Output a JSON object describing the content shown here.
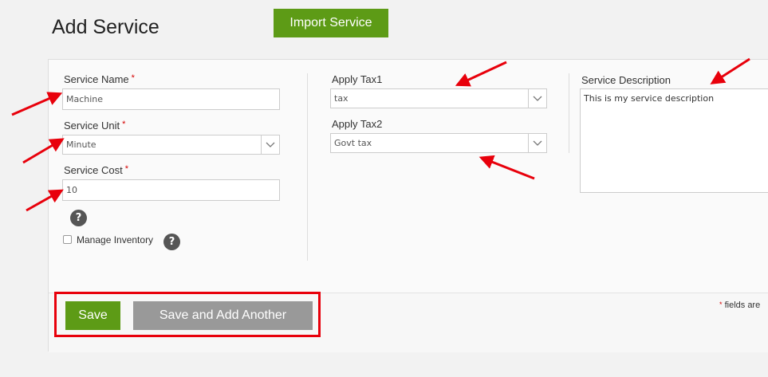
{
  "header": {
    "title": "Add Service",
    "import_label": "Import Service"
  },
  "form": {
    "service_name": {
      "label": "Service Name",
      "required": "*",
      "value": "Machine"
    },
    "service_unit": {
      "label": "Service Unit",
      "required": "*",
      "value": "Minute"
    },
    "service_cost": {
      "label": "Service Cost",
      "required": "*",
      "value": "10"
    },
    "help_glyph": "?",
    "manage_inventory": {
      "label": "Manage Inventory",
      "checked": false
    },
    "apply_tax1": {
      "label": "Apply Tax1",
      "value": "tax"
    },
    "apply_tax2": {
      "label": "Apply Tax2",
      "value": "Govt tax"
    },
    "description": {
      "label": "Service Description",
      "value": "This is my service description"
    }
  },
  "footer": {
    "save_label": "Save",
    "save_another_label": "Save and Add Another",
    "required_note_star": "*",
    "required_note": "fields are"
  },
  "annotations": {
    "arrow_color": "#e8000b",
    "highlight_color": "#e8000b"
  },
  "colors": {
    "primary_green": "#5d9b16",
    "secondary_gray": "#999999",
    "required_red": "#d40000"
  }
}
